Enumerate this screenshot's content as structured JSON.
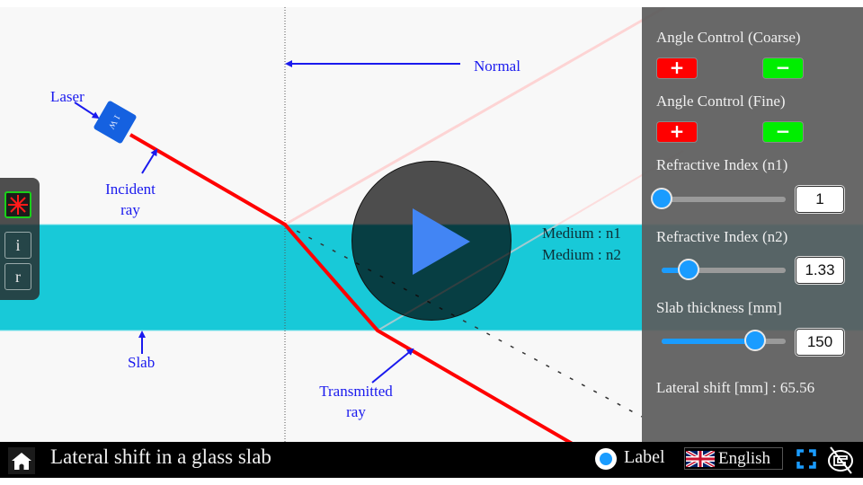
{
  "app": {
    "title": "Lateral shift in a glass slab"
  },
  "scene": {
    "labels": {
      "laser": "Laser",
      "laser_power": "1 W",
      "incident": [
        "Incident",
        "ray"
      ],
      "normal": "Normal",
      "slab": "Slab",
      "transmitted": [
        "Transmitted",
        "ray"
      ],
      "medium1": "Medium : n1",
      "medium2": "Medium : n2"
    },
    "colors": {
      "slab": "#18c9d8",
      "ray": "#ff0000",
      "annotation": "#1a1aee",
      "background": "#f8f8f8"
    }
  },
  "toolbar": {
    "items": [
      {
        "id": "laser",
        "icon": "laser-icon",
        "label": "",
        "active": true
      },
      {
        "id": "i",
        "label": "i",
        "active": false
      },
      {
        "id": "r",
        "label": "r",
        "active": false
      }
    ]
  },
  "panel": {
    "angle_coarse": {
      "title": "Angle Control (Coarse)",
      "plus": "+",
      "minus": "−"
    },
    "angle_fine": {
      "title": "Angle Control (Fine)",
      "plus": "+",
      "minus": "−"
    },
    "n1": {
      "title": "Refractive Index (n1)",
      "value": "1",
      "fraction": 0.0
    },
    "n2": {
      "title": "Refractive Index (n2)",
      "value": "1.33",
      "fraction": 0.22
    },
    "thickness": {
      "title": "Slab thickness [mm]",
      "value": "150",
      "fraction": 0.75
    },
    "result": "Lateral shift [mm] : 65.56"
  },
  "bottombar": {
    "label_toggle": "Label",
    "label_on": true,
    "language": "English",
    "accent": "#1a9cff"
  },
  "overlay": {
    "play_icon": "play-icon",
    "play_color": "#4285f4"
  }
}
